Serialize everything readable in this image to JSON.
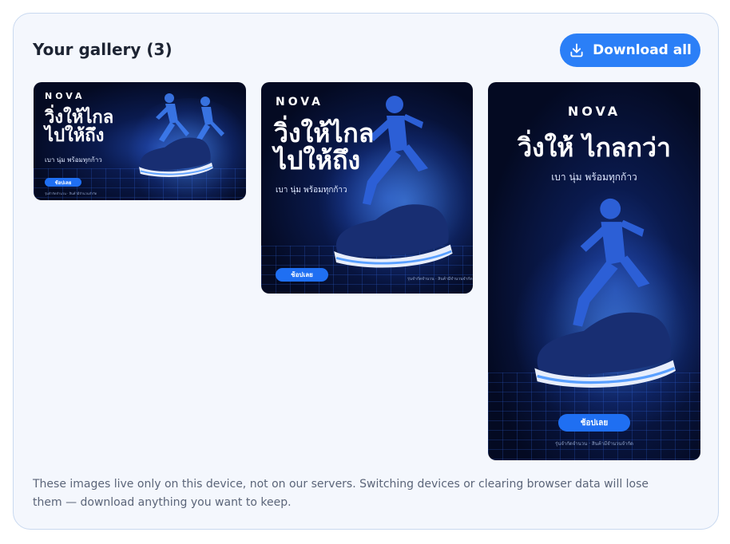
{
  "gallery": {
    "title": "Your gallery (3)",
    "download_all_label": "Download all",
    "notice": "These images live only on this device, not on our servers. Switching devices or clearing browser data will lose them — download anything you want to keep."
  },
  "ads": [
    {
      "brand": "NOVA",
      "headline": "วิ่งให้ไกล\nไปให้ถึง",
      "subtitle": "เบา นุ่ม พร้อมทุกก้าว",
      "cta": "ช้อปเลย",
      "fine_print": "รุ่นจำกัดจำนวน · สินค้ามีจำนวนจำกัด"
    },
    {
      "brand": "NOVA",
      "headline": "วิ่งให้ไกล\nไปให้ถึง",
      "subtitle": "เบา นุ่ม พร้อมทุกก้าว",
      "cta": "ช้อปเลย",
      "fine_print": "รุ่นจำกัดจำนวน · สินค้ามีจำนวนจำกัด"
    },
    {
      "brand": "NOVA",
      "headline": "วิ่งให้ ไกลกว่า",
      "subtitle": "เบา นุ่ม พร้อมทุกก้าว",
      "cta": "ช้อปเลย",
      "fine_print": "รุ่นจำกัดจำนวน · สินค้ามีจำนวนจำกัด"
    }
  ],
  "colors": {
    "accent": "#2b7ff7",
    "panel_bg": "#f4f7fd",
    "panel_border": "#c9d9f0"
  },
  "icons": {
    "download": "download-icon"
  }
}
